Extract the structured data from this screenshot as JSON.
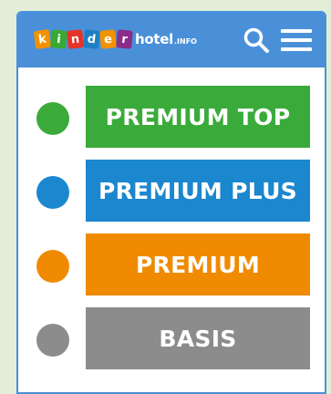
{
  "header": {
    "logo": {
      "letters": [
        "k",
        "i",
        "n",
        "d",
        "e",
        "r"
      ],
      "rest": "hotel",
      "suffix": ".INFO"
    },
    "search_icon": "search-icon",
    "menu_icon": "hamburger-menu-icon",
    "color": "#4a90d9"
  },
  "tiers": [
    {
      "label": "PREMIUM TOP",
      "color": "#3aab3a"
    },
    {
      "label": "PREMIUM PLUS",
      "color": "#1b87cf"
    },
    {
      "label": "PREMIUM",
      "color": "#f08a00"
    },
    {
      "label": "BASIS",
      "color": "#8c8c8c"
    }
  ]
}
